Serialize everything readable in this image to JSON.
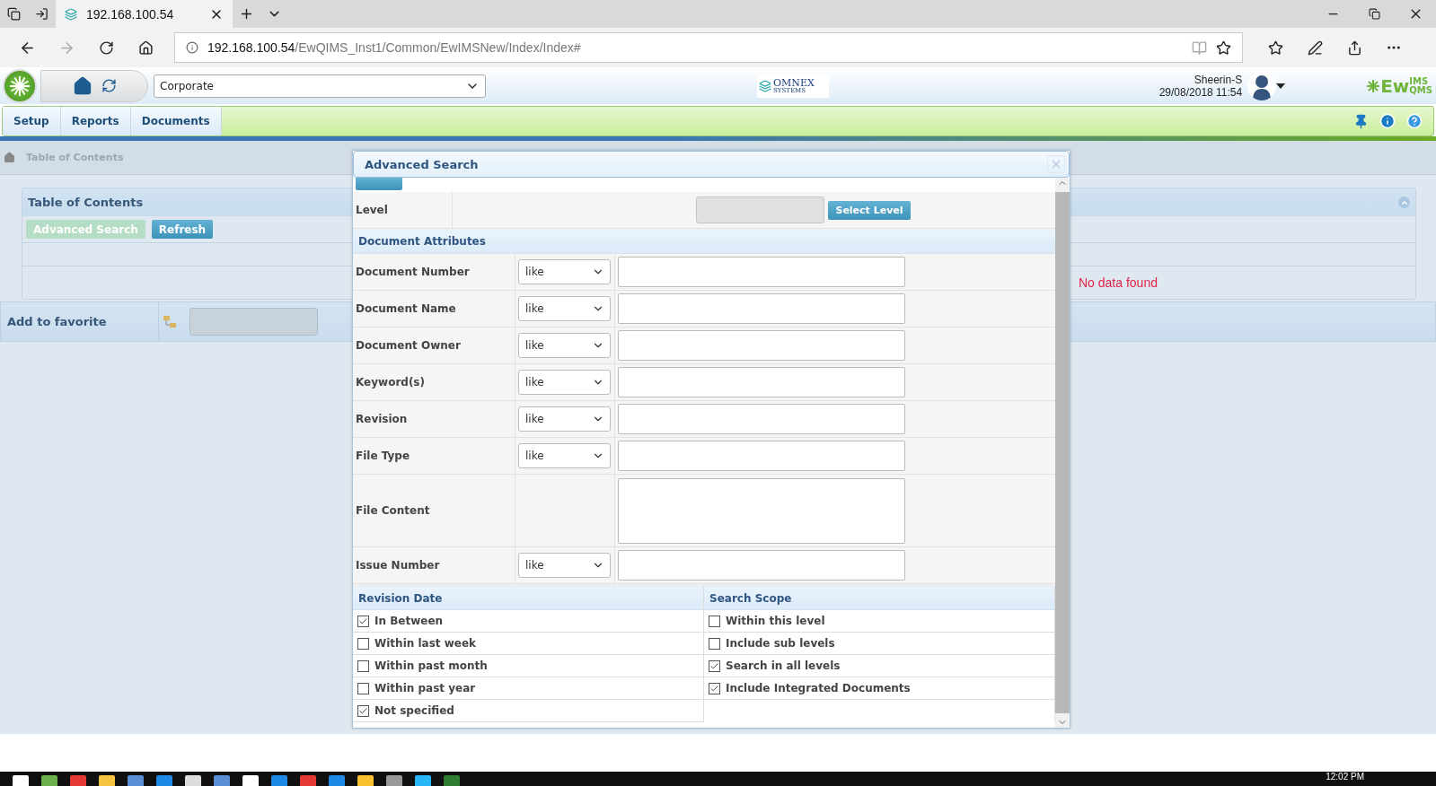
{
  "browser": {
    "tab_title": "192.168.100.54",
    "url_host": "192.168.100.54",
    "url_path": "/EwQIMS_Inst1/Common/EwIMSNew/Index/Index#"
  },
  "header": {
    "organization": "Corporate",
    "omnex_logo": {
      "name": "OMNEX",
      "tagline": "SYSTEMS"
    },
    "user": "Sheerin-S",
    "datetime": "29/08/2018 11:54",
    "brand": {
      "main": "Ew",
      "top": "IMS",
      "bottom": "QMS"
    }
  },
  "menu": [
    {
      "label": "Setup"
    },
    {
      "label": "Reports"
    },
    {
      "label": "Documents"
    }
  ],
  "breadcrumb": [
    "Table of Contents"
  ],
  "panel": {
    "title": "Table of Contents",
    "buttons": [
      {
        "label": "Advanced Search",
        "disabled": true
      },
      {
        "label": "Refresh",
        "disabled": false
      }
    ],
    "message": "No data found"
  },
  "favorite": {
    "label": "Add to favorite"
  },
  "dialog": {
    "title": "Advanced Search",
    "level": {
      "label": "Level",
      "button": "Select Level"
    },
    "section": "Document Attributes",
    "fields": [
      {
        "label": "Document Number",
        "kind": "text",
        "operator": "like"
      },
      {
        "label": "Document Name",
        "kind": "text",
        "operator": "like"
      },
      {
        "label": "Document Owner",
        "kind": "text",
        "operator": "like"
      },
      {
        "label": "Keyword(s)",
        "kind": "text",
        "operator": "like"
      },
      {
        "label": "Revision",
        "kind": "text",
        "operator": "like"
      },
      {
        "label": "File Type",
        "kind": "text",
        "operator": "like"
      },
      {
        "label": "File Content",
        "kind": "textarea"
      },
      {
        "label": "Issue Number",
        "kind": "text",
        "operator": "like"
      }
    ],
    "revision_date": {
      "title": "Revision Date",
      "options": [
        {
          "label": "In Between",
          "checked": true
        },
        {
          "label": "Within last week",
          "checked": false
        },
        {
          "label": "Within past month",
          "checked": false
        },
        {
          "label": "Within past year",
          "checked": false
        },
        {
          "label": "Not specified",
          "checked": true
        }
      ]
    },
    "search_scope": {
      "title": "Search Scope",
      "options": [
        {
          "label": "Within this level",
          "checked": false
        },
        {
          "label": "Include sub levels",
          "checked": false
        },
        {
          "label": "Search in all levels",
          "checked": true
        },
        {
          "label": "Include Integrated Documents",
          "checked": true
        }
      ]
    }
  },
  "taskbar": {
    "clock": "12:02 PM"
  }
}
